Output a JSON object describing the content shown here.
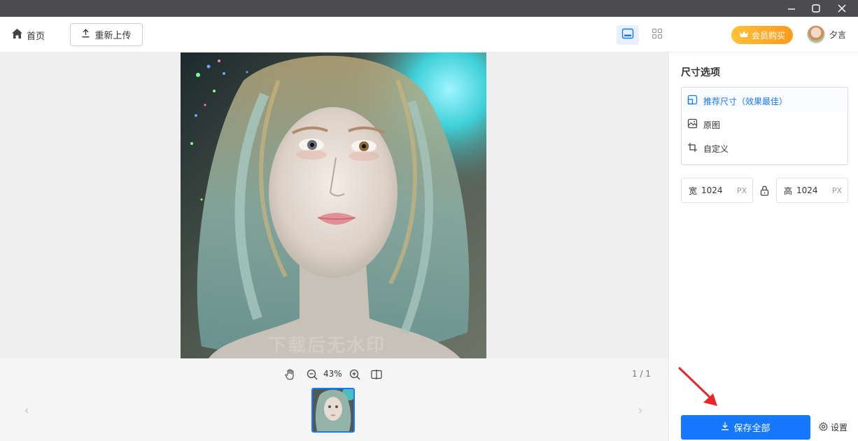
{
  "titlebar": {
    "minimize_icon": "minimize-icon",
    "maximize_icon": "maximize-icon",
    "close_icon": "close-icon"
  },
  "header": {
    "home_label": "首页",
    "reupload_label": "重新上传",
    "vip_label": "会员购买",
    "user_name": "夕言"
  },
  "viewer": {
    "watermark": "下载后无水印",
    "zoom": "43%",
    "page": "1 / 1",
    "prev_arrow": "‹",
    "next_arrow": "›"
  },
  "panel": {
    "title": "尺寸选项",
    "options": [
      {
        "label": "推荐尺寸（效果最佳）",
        "icon": "recommended-size-icon",
        "selected": true
      },
      {
        "label": "原图",
        "icon": "image-icon",
        "selected": false
      },
      {
        "label": "自定义",
        "icon": "crop-icon",
        "selected": false
      }
    ],
    "width": {
      "label": "宽",
      "value": "1024",
      "unit": "PX"
    },
    "height": {
      "label": "高",
      "value": "1024",
      "unit": "PX"
    },
    "save_all_label": "保存全部",
    "settings_label": "设置"
  },
  "colors": {
    "accent": "#1677ff",
    "vip_gradient_start": "#ffc13a",
    "vip_gradient_end": "#ff9a1f",
    "titlebar": "#4b4b50",
    "annotation_arrow": "#e8262b"
  }
}
